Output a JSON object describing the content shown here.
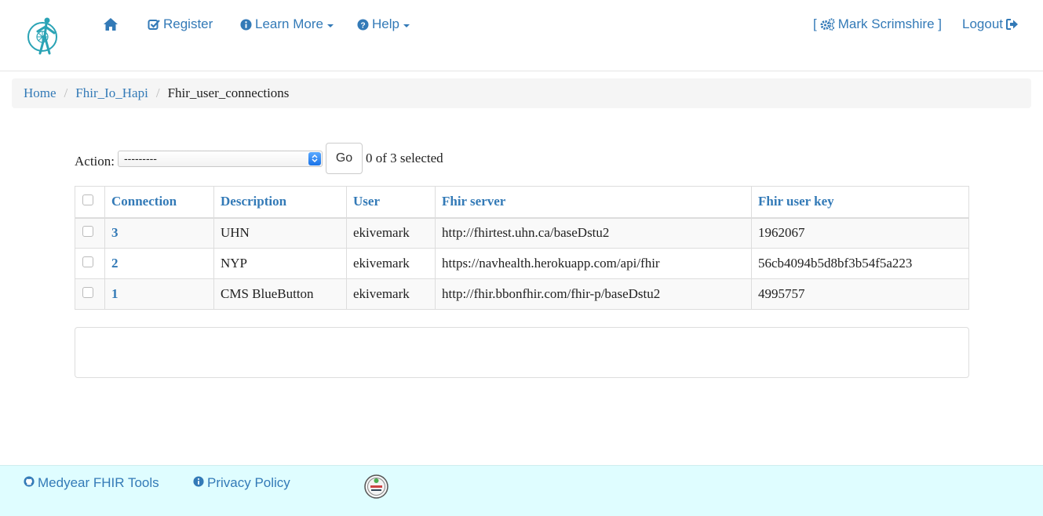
{
  "nav": {
    "register": "Register",
    "learn_more": "Learn More",
    "help": "Help",
    "user": "Mark Scrimshire ]",
    "user_prefix": "[",
    "logout": "Logout"
  },
  "breadcrumb": {
    "home": "Home",
    "app": "Fhir_Io_Hapi",
    "current": "Fhir_user_connections",
    "separator": "/"
  },
  "actions": {
    "label": "Action:",
    "select_value": "---------",
    "go": "Go",
    "selected_count": "0 of 3 selected"
  },
  "table": {
    "headers": [
      "Connection",
      "Description",
      "User",
      "Fhir server",
      "Fhir user key"
    ],
    "rows": [
      {
        "connection": "3",
        "description": "UHN",
        "user": "ekivemark",
        "server": "http://fhirtest.uhn.ca/baseDstu2",
        "key": "1962067"
      },
      {
        "connection": "2",
        "description": "NYP",
        "user": "ekivemark",
        "server": "https://navhealth.herokuapp.com/api/fhir",
        "key": "56cb4094b5d8bf3b54f5a223"
      },
      {
        "connection": "1",
        "description": "CMS BlueButton",
        "user": "ekivemark",
        "server": "http://fhir.bbonfhir.com/fhir-p/baseDstu2",
        "key": "4995757"
      }
    ]
  },
  "footer": {
    "tools": "Medyear FHIR Tools",
    "privacy": "Privacy Policy"
  },
  "colors": {
    "link": "#337ab7",
    "footer_bg": "#dffdff",
    "logo": "#2aa3b5"
  }
}
